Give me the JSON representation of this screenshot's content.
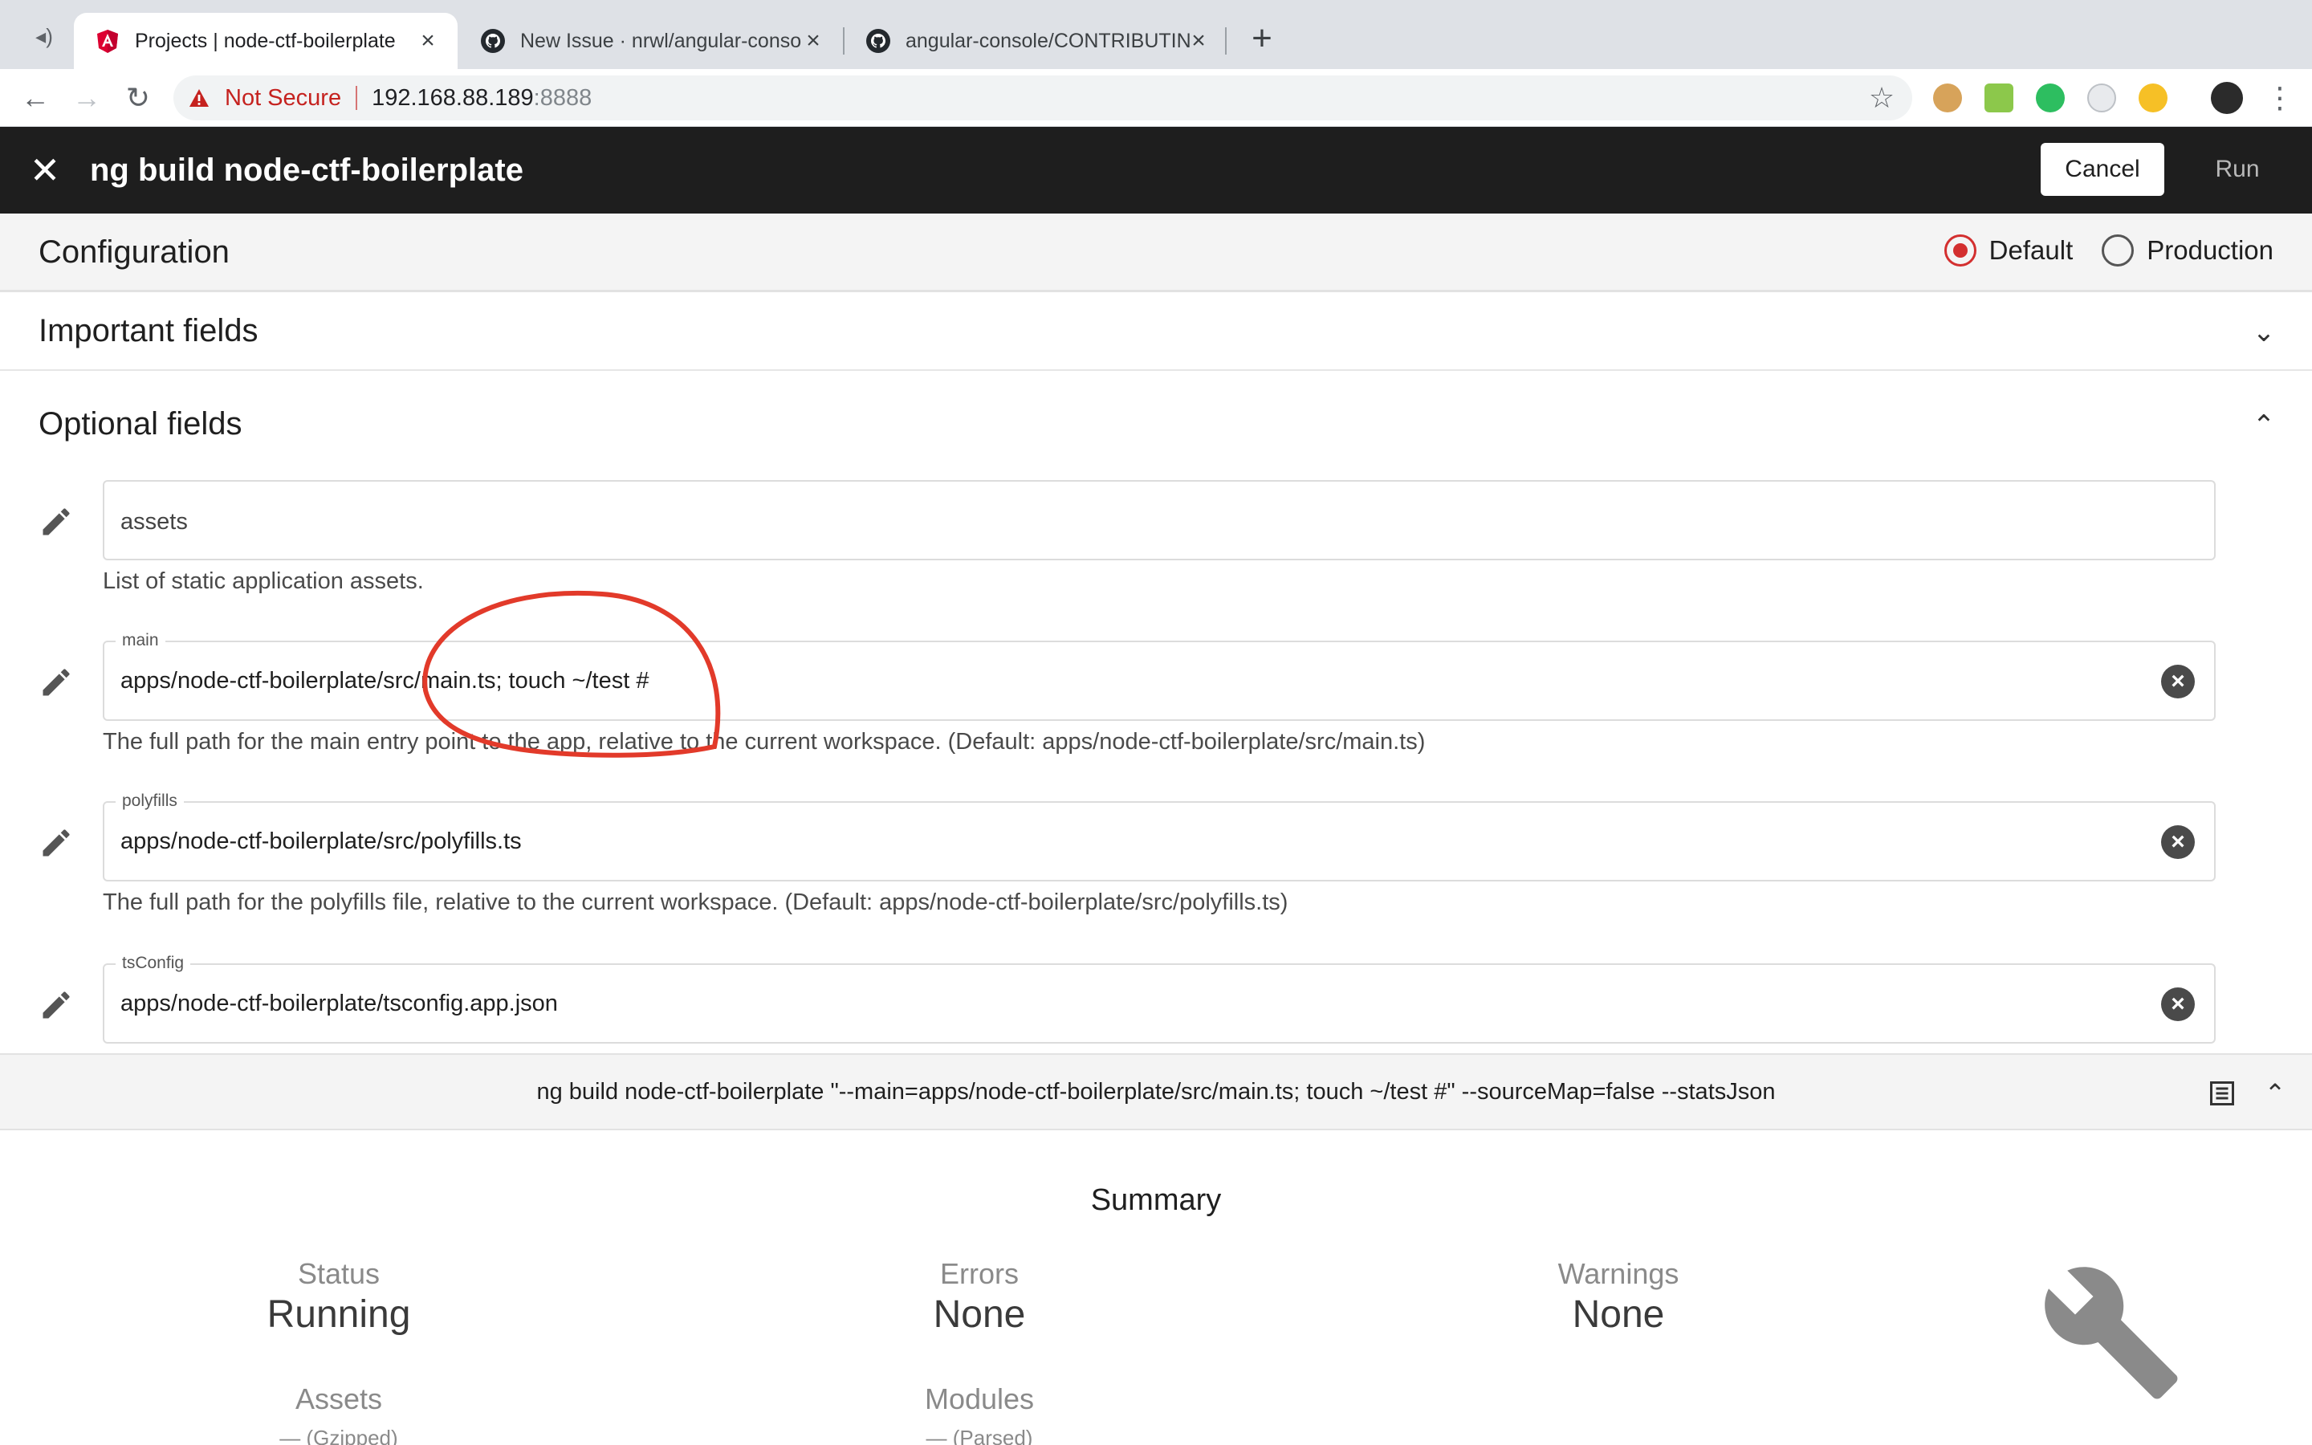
{
  "browser": {
    "tabs": [
      {
        "title": "Projects | node-ctf-boilerplate",
        "icon": "angular-icon",
        "active": true
      },
      {
        "title": "New Issue · nrwl/angular-conso",
        "icon": "github-icon",
        "active": false
      },
      {
        "title": "angular-console/CONTRIBUTIN",
        "icon": "github-icon",
        "active": false
      }
    ],
    "address": {
      "security_label": "Not Secure",
      "host": "192.168.88.189",
      "port": ":8888"
    }
  },
  "header": {
    "title": "ng build node-ctf-boilerplate",
    "cancel_label": "Cancel",
    "run_label": "Run"
  },
  "configuration": {
    "title": "Configuration",
    "options": [
      {
        "label": "Default",
        "selected": true
      },
      {
        "label": "Production",
        "selected": false
      }
    ]
  },
  "sections": {
    "important": {
      "label": "Important fields",
      "expanded": false
    },
    "optional": {
      "label": "Optional fields",
      "expanded": true
    }
  },
  "fields": {
    "assets": {
      "placeholder": "assets",
      "help": "List of static application assets."
    },
    "main": {
      "label": "main",
      "value": "apps/node-ctf-boilerplate/src/main.ts; touch ~/test #",
      "help": "The full path for the main entry point to the app, relative to the current workspace. (Default: apps/node-ctf-boilerplate/src/main.ts)"
    },
    "polyfills": {
      "label": "polyfills",
      "value": "apps/node-ctf-boilerplate/src/polyfills.ts",
      "help": "The full path for the polyfills file, relative to the current workspace. (Default: apps/node-ctf-boilerplate/src/polyfills.ts)"
    },
    "tsConfig": {
      "label": "tsConfig",
      "value": "apps/node-ctf-boilerplate/tsconfig.app.json"
    }
  },
  "command": {
    "text": "ng build node-ctf-boilerplate \"--main=apps/node-ctf-boilerplate/src/main.ts; touch ~/test #\" --sourceMap=false --statsJson"
  },
  "summary": {
    "title": "Summary",
    "status": {
      "label": "Status",
      "value": "Running"
    },
    "errors": {
      "label": "Errors",
      "value": "None"
    },
    "warnings": {
      "label": "Warnings",
      "value": "None"
    },
    "assets": {
      "label": "Assets",
      "sub": "— (Gzipped)"
    },
    "modules": {
      "label": "Modules",
      "sub": "— (Parsed)"
    }
  },
  "colors": {
    "accent_red": "#d32f2f",
    "header_bg": "#1e1e1e",
    "annotation": "#e23a2a"
  }
}
